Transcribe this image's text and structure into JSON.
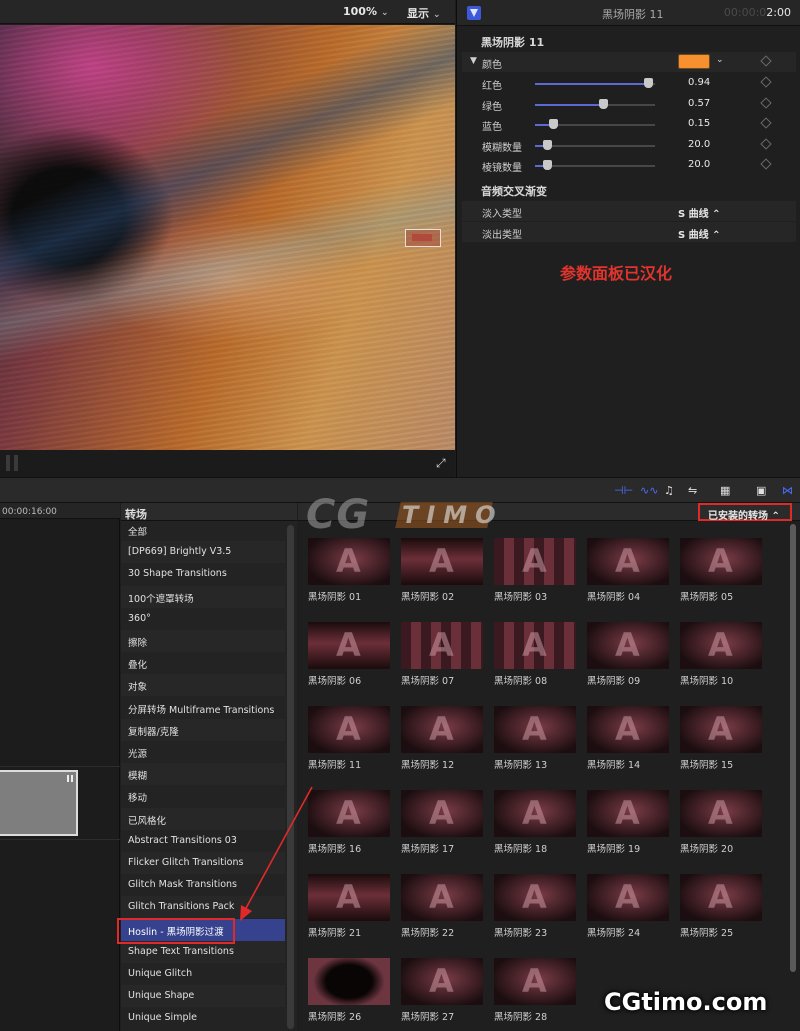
{
  "viewer": {
    "zoom": "100%",
    "display_menu": "显示"
  },
  "inspector": {
    "header_title": "黑场阴影 11",
    "timecode_dim": "00:00:0",
    "timecode": "2:00",
    "effect_name": "黑场阴影 11",
    "color_label": "颜色",
    "color_value": "#f7902e",
    "params": [
      {
        "label": "红色",
        "value": "0.94",
        "fraction": 0.94
      },
      {
        "label": "绿色",
        "value": "0.57",
        "fraction": 0.57
      },
      {
        "label": "蓝色",
        "value": "0.15",
        "fraction": 0.15
      },
      {
        "label": "模糊数量",
        "value": "20.0",
        "fraction": 0.1
      },
      {
        "label": "棱镜数量",
        "value": "20.0",
        "fraction": 0.1
      }
    ],
    "audio_section": "音频交叉渐变",
    "fade_in_label": "淡入类型",
    "fade_in_value": "S 曲线 ⌃",
    "fade_out_label": "淡出类型",
    "fade_out_value": "S 曲线 ⌃"
  },
  "annotation_params": "参数面板已汉化",
  "timeline": {
    "ruler_time": "00:00:16:00"
  },
  "sidebar": {
    "title": "转场",
    "categories": [
      "全部",
      "[DP669] Brightly V3.5",
      "30 Shape Transitions",
      "100个遮罩转场",
      "360°",
      "擦除",
      "叠化",
      "对象",
      "分屏转场 Multiframe Transitions",
      "复制器/克隆",
      "光源",
      "模糊",
      "移动",
      "已风格化",
      "Abstract Transitions 03",
      "Flicker Glitch Transitions",
      "Glitch Mask Transitions",
      "Glitch Transitions Pack",
      "Hoslin - 黑场阴影过渡",
      "Shape Text Transitions",
      "Unique Glitch",
      "Unique Shape",
      "Unique Simple"
    ],
    "selected_index": 18
  },
  "browser": {
    "installed_menu": "已安装的转场 ⌃",
    "items": [
      "黑场阴影 01",
      "黑场阴影 02",
      "黑场阴影 03",
      "黑场阴影 04",
      "黑场阴影 05",
      "黑场阴影 06",
      "黑场阴影 07",
      "黑场阴影 08",
      "黑场阴影 09",
      "黑场阴影 10",
      "黑场阴影 11",
      "黑场阴影 12",
      "黑场阴影 13",
      "黑场阴影 14",
      "黑场阴影 15",
      "黑场阴影 16",
      "黑场阴影 17",
      "黑场阴影 18",
      "黑场阴影 19",
      "黑场阴影 20",
      "黑场阴影 21",
      "黑场阴影 22",
      "黑场阴影 23",
      "黑场阴影 24",
      "黑场阴影 25",
      "黑场阴影 26",
      "黑场阴影 27",
      "黑场阴影 28"
    ],
    "thumb_glyph": "A"
  },
  "watermark": {
    "center_cg": "CG",
    "center_timo": "TIMO",
    "corner": "CGtimo.com"
  },
  "colors": {
    "accent": "#36428e",
    "annotation": "#e02a2a"
  }
}
